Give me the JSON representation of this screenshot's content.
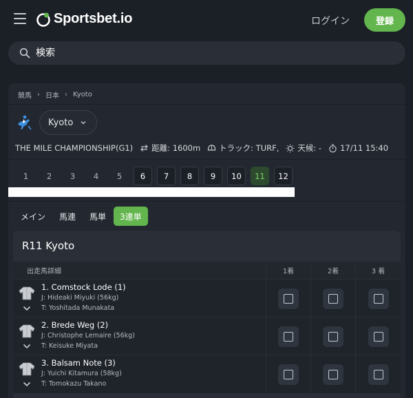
{
  "header": {
    "brand": "Sportsbet.io",
    "login_label": "ログイン",
    "register_label": "登録",
    "brand_color": "#63b54e"
  },
  "search": {
    "placeholder": "検索"
  },
  "breadcrumb": [
    "競馬",
    "日本",
    "Kyoto"
  ],
  "venue": {
    "selected": "Kyoto"
  },
  "race_info": {
    "name": "THE MILE CHAMPIONSHIP(G1)",
    "distance": "距離: 1600m",
    "track": "トラック: TURF,",
    "weather": "天候: -",
    "time": "17/11 15:40"
  },
  "race_tabs": [
    {
      "label": "1",
      "state": "closed"
    },
    {
      "label": "2",
      "state": "closed"
    },
    {
      "label": "3",
      "state": "closed"
    },
    {
      "label": "4",
      "state": "closed"
    },
    {
      "label": "5",
      "state": "closed"
    },
    {
      "label": "6",
      "state": "open"
    },
    {
      "label": "7",
      "state": "open"
    },
    {
      "label": "8",
      "state": "open"
    },
    {
      "label": "9",
      "state": "open"
    },
    {
      "label": "10",
      "state": "open"
    },
    {
      "label": "11",
      "state": "active"
    },
    {
      "label": "12",
      "state": "open"
    }
  ],
  "bet_tabs": [
    {
      "label": "メイン",
      "active": false
    },
    {
      "label": "馬連",
      "active": false
    },
    {
      "label": "馬単",
      "active": false
    },
    {
      "label": "3連単",
      "active": true
    }
  ],
  "race_card": {
    "title": "R11 Kyoto",
    "columns": {
      "runner": "出走馬詳細",
      "first": "1着",
      "second": "2着",
      "third": "3 着"
    },
    "runners": [
      {
        "name": "1. Comstock Lode (1)",
        "jockey": "J: Hideaki Miyuki (56kg)",
        "trainer": "T: Yoshitada Munakata"
      },
      {
        "name": "2. Brede Weg (2)",
        "jockey": "J: Christophe Lemaire (56kg)",
        "trainer": "T: Keisuke Miyata"
      },
      {
        "name": "3. Balsam Note (3)",
        "jockey": "J: Yuichi Kitamura (58kg)",
        "trainer": "T: Tomokazu Takano"
      }
    ]
  }
}
